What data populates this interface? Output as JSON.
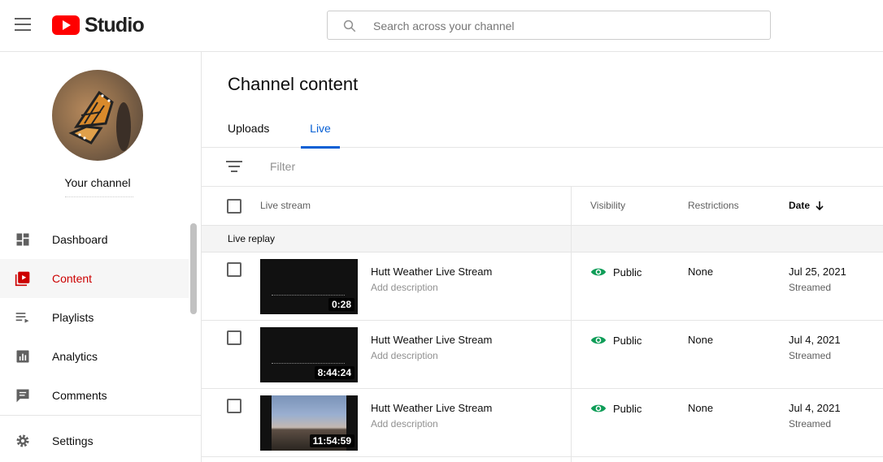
{
  "header": {
    "logo_text": "Studio",
    "search_placeholder": "Search across your channel"
  },
  "sidebar": {
    "channel_label": "Your channel",
    "items": [
      {
        "label": "Dashboard",
        "icon": "dashboard-icon",
        "active": false
      },
      {
        "label": "Content",
        "icon": "content-icon",
        "active": true
      },
      {
        "label": "Playlists",
        "icon": "playlists-icon",
        "active": false
      },
      {
        "label": "Analytics",
        "icon": "analytics-icon",
        "active": false
      },
      {
        "label": "Comments",
        "icon": "comments-icon",
        "active": false
      }
    ],
    "settings_label": "Settings"
  },
  "main": {
    "title": "Channel content",
    "tabs": [
      {
        "label": "Uploads",
        "active": false
      },
      {
        "label": "Live",
        "active": true
      }
    ],
    "filter_placeholder": "Filter",
    "columns": {
      "live_stream": "Live stream",
      "visibility": "Visibility",
      "restrictions": "Restrictions",
      "date": "Date"
    },
    "section_label": "Live replay",
    "rows": [
      {
        "title": "Hutt Weather Live Stream",
        "description": "Add description",
        "duration": "0:28",
        "visibility": "Public",
        "restrictions": "None",
        "date": "Jul 25, 2021",
        "date_sub": "Streamed"
      },
      {
        "title": "Hutt Weather Live Stream",
        "description": "Add description",
        "duration": "8:44:24",
        "visibility": "Public",
        "restrictions": "None",
        "date": "Jul 4, 2021",
        "date_sub": "Streamed"
      },
      {
        "title": "Hutt Weather Live Stream",
        "description": "Add description",
        "duration": "11:54:59",
        "visibility": "Public",
        "restrictions": "None",
        "date": "Jul 4, 2021",
        "date_sub": "Streamed"
      }
    ]
  },
  "colors": {
    "brand_red": "#ff0000",
    "active_nav_text": "#cc0000",
    "tab_active": "#065fd4",
    "public_eye": "#0f9d58"
  }
}
